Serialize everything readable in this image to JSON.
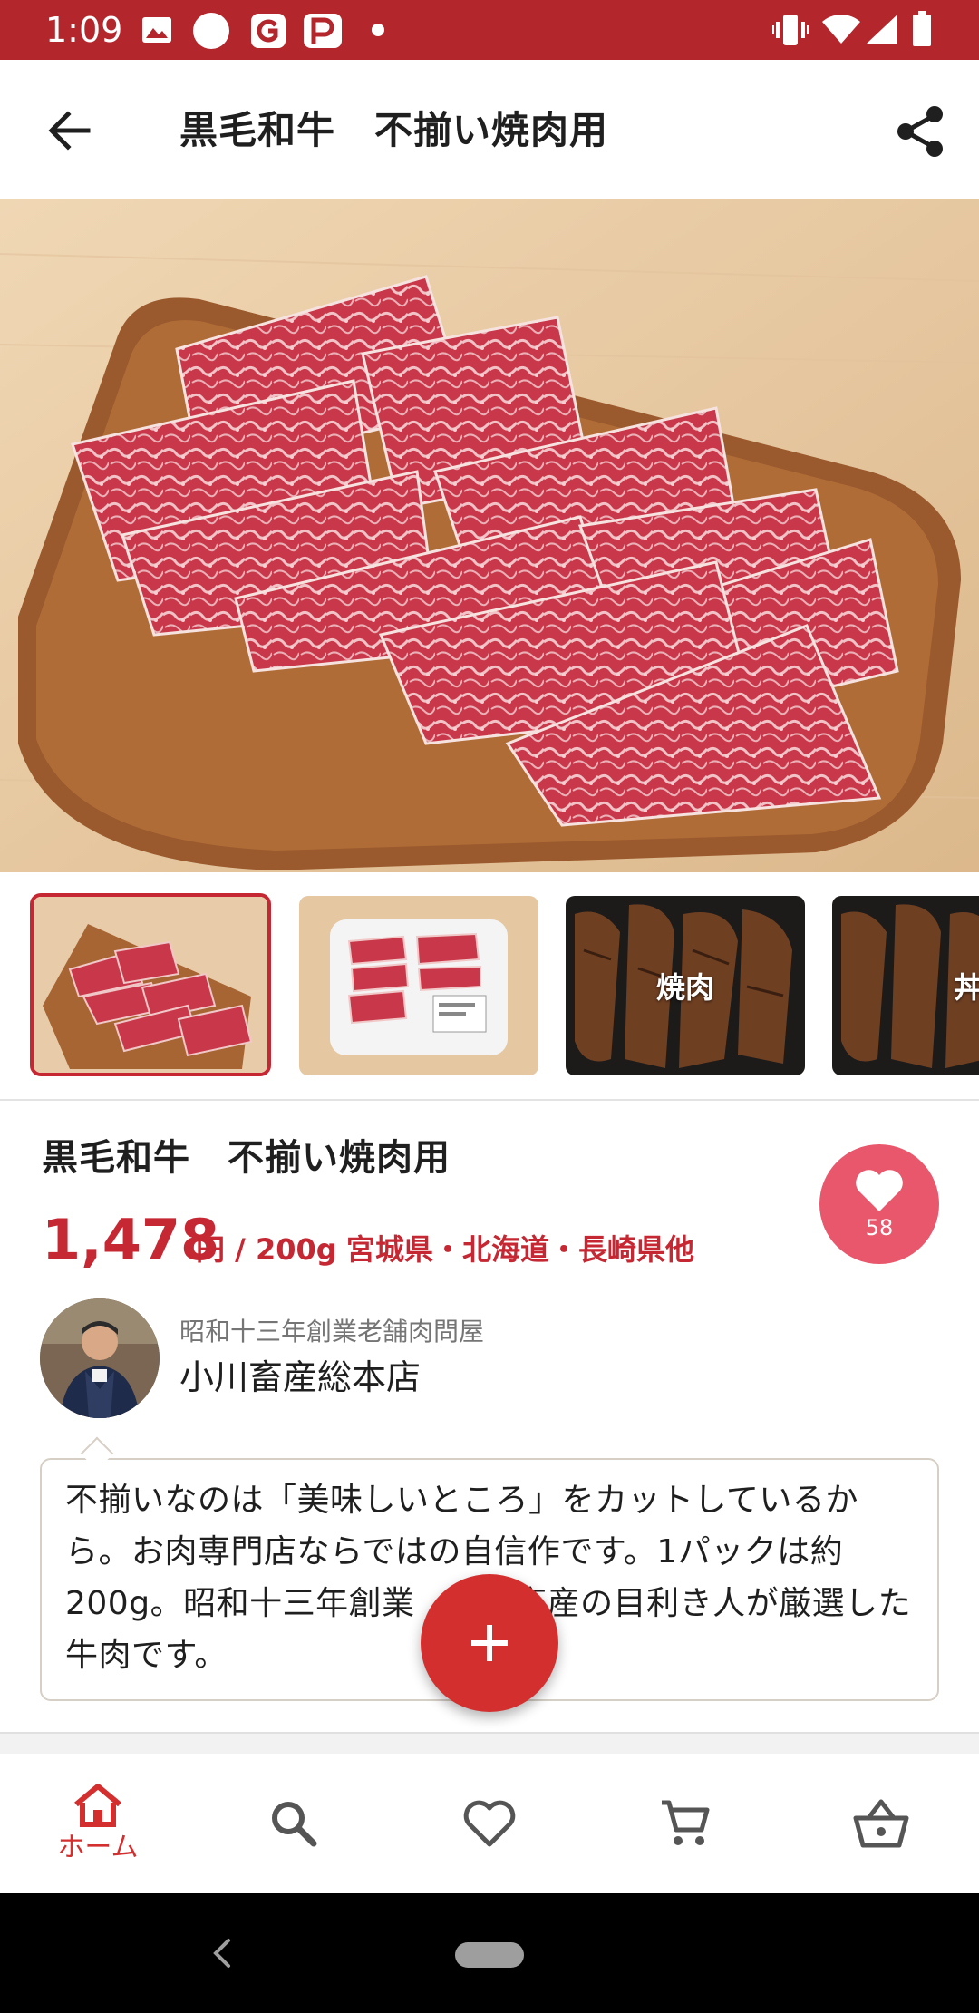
{
  "status_bar": {
    "time": "1:09",
    "left_icons": [
      "image-icon",
      "circle-icon",
      "g-app-icon",
      "p-app-icon",
      "notification-dot-icon"
    ],
    "right_icons": [
      "vibrate-icon",
      "wifi-icon",
      "signal-icon",
      "battery-icon"
    ],
    "color": "#b3262c"
  },
  "app_bar": {
    "title": "黒毛和牛　不揃い焼肉用",
    "back_icon": "arrow-back-icon",
    "share_icon": "share-icon"
  },
  "thumbnails": [
    {
      "label": "",
      "selected": true
    },
    {
      "label": "",
      "selected": false
    },
    {
      "label": "焼肉",
      "selected": false
    },
    {
      "label": "丼",
      "selected": false
    }
  ],
  "product": {
    "name": "黒毛和牛　不揃い焼肉用",
    "price": "1,478",
    "unit": "円 / 200g",
    "origin": "宮城県・北海道・長崎県他",
    "likes": "58",
    "accent_color": "#c62833"
  },
  "seller": {
    "tagline": "昭和十三年創業老舗肉問屋",
    "name": "小川畜産総本店"
  },
  "description": "不揃いなのは「美味しいところ」をカットしているから。お肉専門店ならではの自信作です。1パックは約200g。昭和十三年創業　　　畜産の目利き人が厳選した牛肉です。",
  "fab": {
    "icon": "plus-icon"
  },
  "bottom_nav": {
    "items": [
      {
        "icon": "home-icon",
        "label": "ホーム",
        "active": true
      },
      {
        "icon": "search-icon",
        "label": "",
        "active": false
      },
      {
        "icon": "heart-icon",
        "label": "",
        "active": false
      },
      {
        "icon": "cart-icon",
        "label": "",
        "active": false
      },
      {
        "icon": "basket-icon",
        "label": "",
        "active": false
      }
    ],
    "active_color": "#d32f2f"
  }
}
